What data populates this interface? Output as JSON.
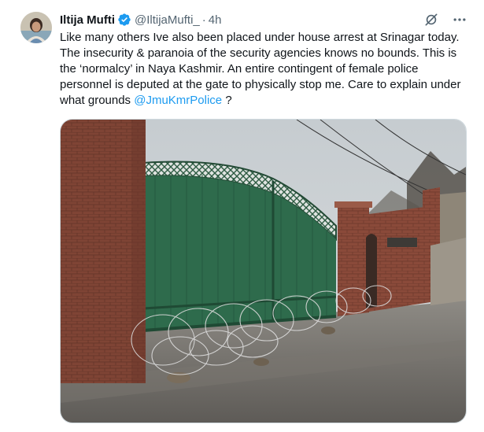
{
  "author": {
    "name": "Iltija Mufti",
    "handle": "@IltijaMufti_",
    "separator": "·",
    "time": "4h"
  },
  "tweet": {
    "text_before_mention": "Like many others Ive also been placed under house arrest at Srinagar today. The insecurity & paranoia of the security agencies knows no bounds. This is the ‘normalcy’ in Naya Kashmir. An entire contingent of female police personnel is deputed at the gate to physically stop me. Care to explain under what grounds ",
    "mention": "@JmuKmrPolice",
    "text_after_mention": " ?"
  },
  "colors": {
    "link": "#1d9bf0",
    "verified": "#1d9bf0",
    "secondary_text": "#536471",
    "gate_green": "#2e6b4c"
  },
  "icons": {
    "verified": "verified-badge-icon",
    "grok": "grok-icon",
    "more": "more-icon"
  }
}
